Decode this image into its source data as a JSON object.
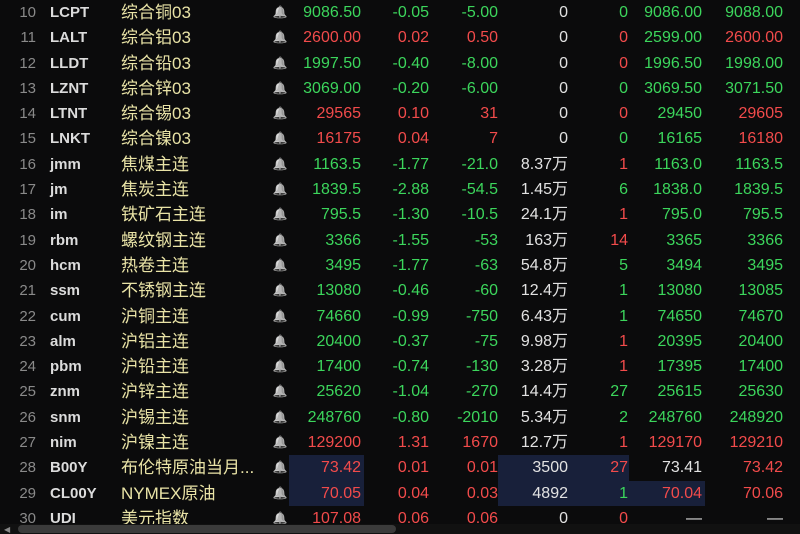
{
  "colors": {
    "up": "#f24b4b",
    "down": "#3cd65c",
    "flat": "#e2e2e2",
    "name": "#e9e3a6"
  },
  "rows": [
    {
      "num": "10",
      "code": "LCPT",
      "name": "综合铜03",
      "price": [
        "9086.50",
        "g"
      ],
      "chg": [
        "-0.05",
        "g"
      ],
      "chg2": [
        "-5.00",
        "g"
      ],
      "vol": [
        "0",
        "w"
      ],
      "hand": [
        "0",
        "g"
      ],
      "bid": [
        "9086.00",
        "g"
      ],
      "ask": [
        "9088.00",
        "g"
      ]
    },
    {
      "num": "11",
      "code": "LALT",
      "name": "综合铝03",
      "price": [
        "2600.00",
        "r"
      ],
      "chg": [
        "0.02",
        "r"
      ],
      "chg2": [
        "0.50",
        "r"
      ],
      "vol": [
        "0",
        "w"
      ],
      "hand": [
        "0",
        "r"
      ],
      "bid": [
        "2599.00",
        "g"
      ],
      "ask": [
        "2600.00",
        "r"
      ]
    },
    {
      "num": "12",
      "code": "LLDT",
      "name": "综合铅03",
      "price": [
        "1997.50",
        "g"
      ],
      "chg": [
        "-0.40",
        "g"
      ],
      "chg2": [
        "-8.00",
        "g"
      ],
      "vol": [
        "0",
        "w"
      ],
      "hand": [
        "0",
        "r"
      ],
      "bid": [
        "1996.50",
        "g"
      ],
      "ask": [
        "1998.00",
        "g"
      ]
    },
    {
      "num": "13",
      "code": "LZNT",
      "name": "综合锌03",
      "price": [
        "3069.00",
        "g"
      ],
      "chg": [
        "-0.20",
        "g"
      ],
      "chg2": [
        "-6.00",
        "g"
      ],
      "vol": [
        "0",
        "w"
      ],
      "hand": [
        "0",
        "g"
      ],
      "bid": [
        "3069.50",
        "g"
      ],
      "ask": [
        "3071.50",
        "g"
      ]
    },
    {
      "num": "14",
      "code": "LTNT",
      "name": "综合锡03",
      "price": [
        "29565",
        "r"
      ],
      "chg": [
        "0.10",
        "r"
      ],
      "chg2": [
        "31",
        "r"
      ],
      "vol": [
        "0",
        "w"
      ],
      "hand": [
        "0",
        "r"
      ],
      "bid": [
        "29450",
        "g"
      ],
      "ask": [
        "29605",
        "r"
      ]
    },
    {
      "num": "15",
      "code": "LNKT",
      "name": "综合镍03",
      "price": [
        "16175",
        "r"
      ],
      "chg": [
        "0.04",
        "r"
      ],
      "chg2": [
        "7",
        "r"
      ],
      "vol": [
        "0",
        "w"
      ],
      "hand": [
        "0",
        "g"
      ],
      "bid": [
        "16165",
        "g"
      ],
      "ask": [
        "16180",
        "r"
      ]
    },
    {
      "num": "16",
      "code": "jmm",
      "name": "焦煤主连",
      "price": [
        "1163.5",
        "g"
      ],
      "chg": [
        "-1.77",
        "g"
      ],
      "chg2": [
        "-21.0",
        "g"
      ],
      "vol": [
        "8.37万",
        "w"
      ],
      "hand": [
        "1",
        "r"
      ],
      "bid": [
        "1163.0",
        "g"
      ],
      "ask": [
        "1163.5",
        "g"
      ]
    },
    {
      "num": "17",
      "code": "jm",
      "name": "焦炭主连",
      "price": [
        "1839.5",
        "g"
      ],
      "chg": [
        "-2.88",
        "g"
      ],
      "chg2": [
        "-54.5",
        "g"
      ],
      "vol": [
        "1.45万",
        "w"
      ],
      "hand": [
        "6",
        "g"
      ],
      "bid": [
        "1838.0",
        "g"
      ],
      "ask": [
        "1839.5",
        "g"
      ]
    },
    {
      "num": "18",
      "code": "im",
      "name": "铁矿石主连",
      "price": [
        "795.5",
        "g"
      ],
      "chg": [
        "-1.30",
        "g"
      ],
      "chg2": [
        "-10.5",
        "g"
      ],
      "vol": [
        "24.1万",
        "w"
      ],
      "hand": [
        "1",
        "r"
      ],
      "bid": [
        "795.0",
        "g"
      ],
      "ask": [
        "795.5",
        "g"
      ]
    },
    {
      "num": "19",
      "code": "rbm",
      "name": "螺纹钢主连",
      "price": [
        "3366",
        "g"
      ],
      "chg": [
        "-1.55",
        "g"
      ],
      "chg2": [
        "-53",
        "g"
      ],
      "vol": [
        "163万",
        "w"
      ],
      "hand": [
        "14",
        "r"
      ],
      "bid": [
        "3365",
        "g"
      ],
      "ask": [
        "3366",
        "g"
      ]
    },
    {
      "num": "20",
      "code": "hcm",
      "name": "热卷主连",
      "price": [
        "3495",
        "g"
      ],
      "chg": [
        "-1.77",
        "g"
      ],
      "chg2": [
        "-63",
        "g"
      ],
      "vol": [
        "54.8万",
        "w"
      ],
      "hand": [
        "5",
        "g"
      ],
      "bid": [
        "3494",
        "g"
      ],
      "ask": [
        "3495",
        "g"
      ]
    },
    {
      "num": "21",
      "code": "ssm",
      "name": "不锈钢主连",
      "price": [
        "13080",
        "g"
      ],
      "chg": [
        "-0.46",
        "g"
      ],
      "chg2": [
        "-60",
        "g"
      ],
      "vol": [
        "12.4万",
        "w"
      ],
      "hand": [
        "1",
        "g"
      ],
      "bid": [
        "13080",
        "g"
      ],
      "ask": [
        "13085",
        "g"
      ]
    },
    {
      "num": "22",
      "code": "cum",
      "name": "沪铜主连",
      "price": [
        "74660",
        "g"
      ],
      "chg": [
        "-0.99",
        "g"
      ],
      "chg2": [
        "-750",
        "g"
      ],
      "vol": [
        "6.43万",
        "w"
      ],
      "hand": [
        "1",
        "g"
      ],
      "bid": [
        "74650",
        "g"
      ],
      "ask": [
        "74670",
        "g"
      ]
    },
    {
      "num": "23",
      "code": "alm",
      "name": "沪铝主连",
      "price": [
        "20400",
        "g"
      ],
      "chg": [
        "-0.37",
        "g"
      ],
      "chg2": [
        "-75",
        "g"
      ],
      "vol": [
        "9.98万",
        "w"
      ],
      "hand": [
        "1",
        "r"
      ],
      "bid": [
        "20395",
        "g"
      ],
      "ask": [
        "20400",
        "g"
      ]
    },
    {
      "num": "24",
      "code": "pbm",
      "name": "沪铅主连",
      "price": [
        "17400",
        "g"
      ],
      "chg": [
        "-0.74",
        "g"
      ],
      "chg2": [
        "-130",
        "g"
      ],
      "vol": [
        "3.28万",
        "w"
      ],
      "hand": [
        "1",
        "r"
      ],
      "bid": [
        "17395",
        "g"
      ],
      "ask": [
        "17400",
        "g"
      ]
    },
    {
      "num": "25",
      "code": "znm",
      "name": "沪锌主连",
      "price": [
        "25620",
        "g"
      ],
      "chg": [
        "-1.04",
        "g"
      ],
      "chg2": [
        "-270",
        "g"
      ],
      "vol": [
        "14.4万",
        "w"
      ],
      "hand": [
        "27",
        "g"
      ],
      "bid": [
        "25615",
        "g"
      ],
      "ask": [
        "25630",
        "g"
      ]
    },
    {
      "num": "26",
      "code": "snm",
      "name": "沪锡主连",
      "price": [
        "248760",
        "g"
      ],
      "chg": [
        "-0.80",
        "g"
      ],
      "chg2": [
        "-2010",
        "g"
      ],
      "vol": [
        "5.34万",
        "w"
      ],
      "hand": [
        "2",
        "g"
      ],
      "bid": [
        "248760",
        "g"
      ],
      "ask": [
        "248920",
        "g"
      ]
    },
    {
      "num": "27",
      "code": "nim",
      "name": "沪镍主连",
      "price": [
        "129200",
        "r"
      ],
      "chg": [
        "1.31",
        "r"
      ],
      "chg2": [
        "1670",
        "r"
      ],
      "vol": [
        "12.7万",
        "w"
      ],
      "hand": [
        "1",
        "r"
      ],
      "bid": [
        "129170",
        "r"
      ],
      "ask": [
        "129210",
        "r"
      ]
    },
    {
      "num": "28",
      "code": "B00Y",
      "name": "布伦特原油当月...",
      "price": [
        "73.42",
        "r"
      ],
      "chg": [
        "0.01",
        "r"
      ],
      "chg2": [
        "0.01",
        "r"
      ],
      "vol": [
        "3500",
        "w"
      ],
      "hand": [
        "27",
        "r"
      ],
      "bid": [
        "73.41",
        "w"
      ],
      "ask": [
        "73.42",
        "r"
      ],
      "hl": [
        "price",
        "vol",
        "hand"
      ]
    },
    {
      "num": "29",
      "code": "CL00Y",
      "name": "NYMEX原油",
      "price": [
        "70.05",
        "r"
      ],
      "chg": [
        "0.04",
        "r"
      ],
      "chg2": [
        "0.03",
        "r"
      ],
      "vol": [
        "4892",
        "w"
      ],
      "hand": [
        "1",
        "g"
      ],
      "bid": [
        "70.04",
        "r"
      ],
      "ask": [
        "70.06",
        "r"
      ],
      "hl": [
        "price",
        "vol",
        "hand",
        "bid"
      ]
    },
    {
      "num": "30",
      "code": "UDI",
      "name": "美元指数",
      "price": [
        "107.08",
        "r"
      ],
      "chg": [
        "0.06",
        "r"
      ],
      "chg2": [
        "0.06",
        "r"
      ],
      "vol": [
        "0",
        "w"
      ],
      "hand": [
        "0",
        "r"
      ],
      "bid": [
        "—",
        "w"
      ],
      "ask": [
        "—",
        "w"
      ]
    }
  ]
}
